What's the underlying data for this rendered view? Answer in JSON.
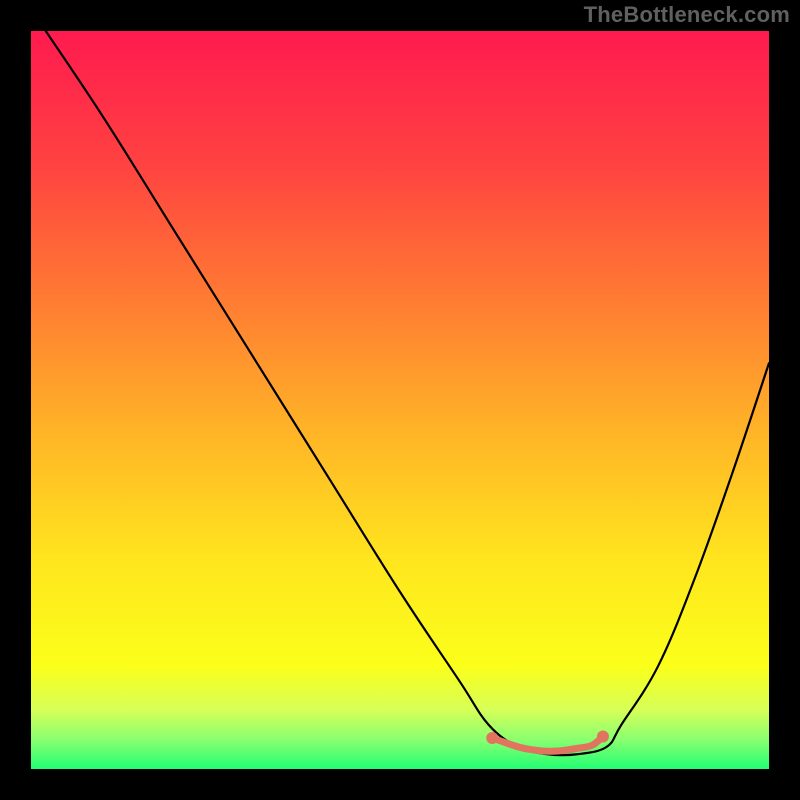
{
  "watermark": "TheBottleneck.com",
  "chart_data": {
    "type": "line",
    "title": "",
    "xlabel": "",
    "ylabel": "",
    "xlim": [
      0,
      100
    ],
    "ylim": [
      0,
      100
    ],
    "grid": false,
    "legend": false,
    "background_gradient": {
      "stops": [
        {
          "offset": 0.0,
          "color": "#ff1a4f"
        },
        {
          "offset": 0.18,
          "color": "#ff4241"
        },
        {
          "offset": 0.36,
          "color": "#ff7a33"
        },
        {
          "offset": 0.54,
          "color": "#ffb327"
        },
        {
          "offset": 0.72,
          "color": "#ffe61e"
        },
        {
          "offset": 0.86,
          "color": "#fbff1a"
        },
        {
          "offset": 0.92,
          "color": "#d6ff58"
        },
        {
          "offset": 0.96,
          "color": "#8aff70"
        },
        {
          "offset": 1.0,
          "color": "#22ff73"
        }
      ]
    },
    "series": [
      {
        "name": "bottleneck-curve",
        "color": "#000000",
        "x": [
          2,
          10,
          20,
          30,
          40,
          50,
          58,
          62,
          66,
          70,
          74,
          78,
          80,
          85,
          90,
          95,
          100
        ],
        "values": [
          100,
          88,
          72,
          56,
          40,
          24,
          12,
          6,
          3,
          2,
          2,
          3,
          6,
          14,
          26,
          40,
          55
        ]
      }
    ],
    "markers": {
      "name": "highlight-band",
      "color": "#e1745e",
      "x": [
        62.5,
        66,
        68,
        70,
        72,
        74,
        76,
        77.5
      ],
      "values": [
        4.2,
        3.0,
        2.6,
        2.4,
        2.5,
        2.8,
        3.2,
        4.4
      ]
    }
  }
}
